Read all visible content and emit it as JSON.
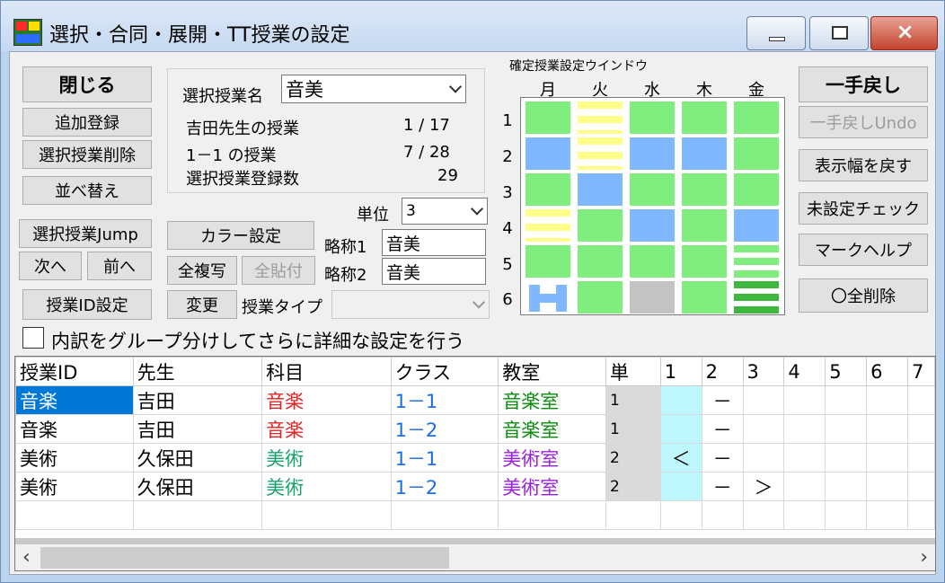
{
  "window": {
    "title": "選択・合同・展開・TT授業の設定",
    "controls": [
      "minimize",
      "maximize",
      "×"
    ]
  },
  "left_buttons": {
    "close": "閉じる",
    "add": "追加登録",
    "delete": "選択授業削除",
    "sort": "並べ替え",
    "jump": "選択授業Jump",
    "next": "次へ",
    "prev": "前へ",
    "id_setting": "授業ID設定"
  },
  "info": {
    "lesson_name_label": "選択授業名",
    "lesson_name_value": "音美",
    "teacher_label": "吉田先生の授業",
    "teacher_count": "1 / 17",
    "class_label": "1－1 の授業",
    "class_count": "7 / 28",
    "registered_label": "選択授業登録数",
    "registered_count": "29"
  },
  "mid_controls": {
    "unit_label": "単位",
    "unit_value": "3",
    "color_setting": "カラー設定",
    "copy_all": "全複写",
    "paste_all": "全貼付",
    "change": "変更",
    "abbr1_label": "略称1",
    "abbr1_value": "音美",
    "abbr2_label": "略称2",
    "abbr2_value": "音美",
    "type_label": "授業タイプ",
    "type_value": ""
  },
  "schedule": {
    "title": "確定授業設定ウインドウ",
    "days": [
      "月",
      "火",
      "水",
      "木",
      "金"
    ],
    "periods": [
      "1",
      "2",
      "3",
      "4",
      "5",
      "6"
    ],
    "cells": [
      [
        "green",
        "stripe-y",
        "green",
        "green",
        "green"
      ],
      [
        "blue",
        "stripe-y",
        "blue",
        "blue",
        "green"
      ],
      [
        "green",
        "blue",
        "green",
        "green",
        "green"
      ],
      [
        "stripe-y",
        "green",
        "blue",
        "green",
        "blue"
      ],
      [
        "green",
        "green",
        "green",
        "green",
        "stripe-g"
      ],
      [
        "hshape",
        "green",
        "gray",
        "green",
        "stripe-dg"
      ]
    ]
  },
  "right_buttons": {
    "undo": "一手戻し",
    "undo_undo": "一手戻しUndo",
    "restore_width": "表示幅を戻す",
    "unset_check": "未設定チェック",
    "mark_help": "マークヘルプ",
    "delete_all": "〇全削除"
  },
  "checkbox_label": "内訳をグループ分けしてさらに詳細な設定を行う",
  "table": {
    "headers": [
      "授業ID",
      "先生",
      "科目",
      "クラス",
      "教室",
      "単",
      "1",
      "2",
      "3",
      "4",
      "5",
      "6",
      "7"
    ],
    "rows": [
      {
        "id": "音楽",
        "teacher": "吉田",
        "subject": "音楽",
        "class": "1－1",
        "room": "音楽室",
        "unit": "1",
        "p1": "",
        "p2": "－",
        "p3": ""
      },
      {
        "id": "音楽",
        "teacher": "吉田",
        "subject": "音楽",
        "class": "1－2",
        "room": "音楽室",
        "unit": "1",
        "p1": "",
        "p2": "－",
        "p3": ""
      },
      {
        "id": "美術",
        "teacher": "久保田",
        "subject": "美術",
        "class": "1－1",
        "room": "美術室",
        "unit": "2",
        "p1": "＜",
        "p2": "－",
        "p3": ""
      },
      {
        "id": "美術",
        "teacher": "久保田",
        "subject": "美術",
        "class": "1－2",
        "room": "美術室",
        "unit": "2",
        "p1": "",
        "p2": "－",
        "p3": "＞"
      }
    ]
  },
  "colors": {
    "green": "#7fee7f",
    "blue": "#7fb8ff",
    "yellow": "#ffff88",
    "selection": "#0078d7"
  }
}
